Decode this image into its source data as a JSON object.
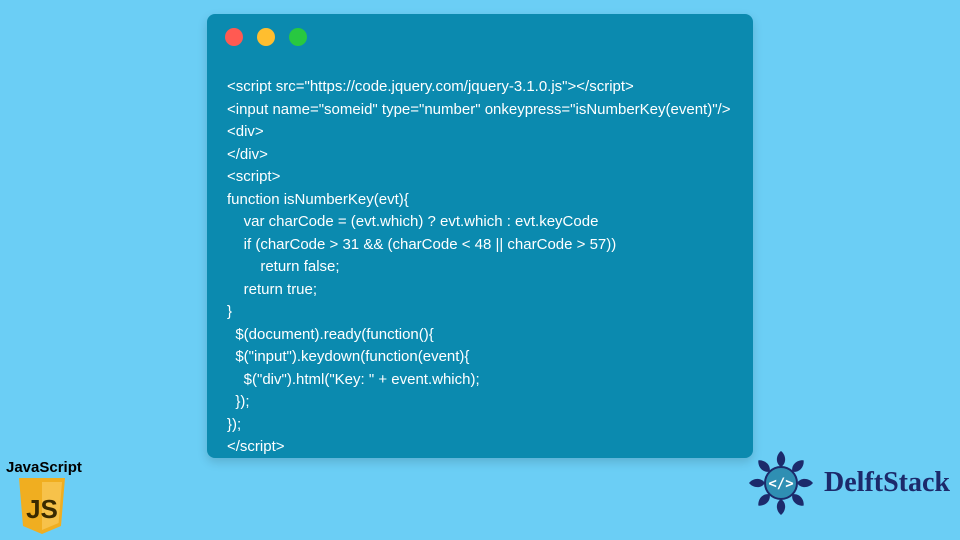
{
  "window": {
    "dots": [
      "#ff5a52",
      "#ffbe2f",
      "#28c840"
    ]
  },
  "code_lines": [
    "<script src=\"https://code.jquery.com/jquery-3.1.0.js\"></script>",
    "<input name=\"someid\" type=\"number\" onkeypress=\"isNumberKey(event)\"/>",
    "<div>",
    "</div>",
    "<script>",
    "function isNumberKey(evt){",
    "    var charCode = (evt.which) ? evt.which : evt.keyCode",
    "    if (charCode > 31 && (charCode < 48 || charCode > 57))",
    "        return false;",
    "    return true;",
    "}",
    "  $(document).ready(function(){",
    "  $(\"input\").keydown(function(event){",
    "    $(\"div\").html(\"Key: \" + event.which);",
    "  });",
    "});",
    "</script>"
  ],
  "js_badge": {
    "label": "JavaScript",
    "logo_text": "JS",
    "bg": "#f0ae20",
    "fg": "#3a2a00"
  },
  "delft": {
    "text": "DelftStack",
    "accent": "#1c2a6b"
  }
}
